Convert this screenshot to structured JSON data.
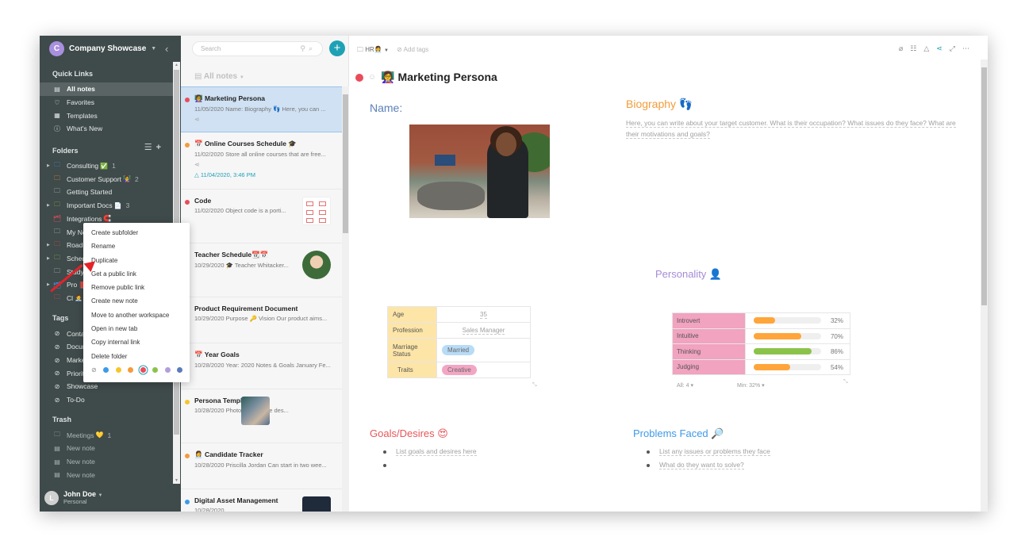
{
  "sidebar": {
    "workspace": {
      "avatar": "C",
      "name": "Company Showcase"
    },
    "quick_links_label": "Quick Links",
    "quick_links": [
      {
        "icon": "note-icon",
        "label": "All notes",
        "active": true
      },
      {
        "icon": "heart-icon",
        "label": "Favorites"
      },
      {
        "icon": "templates-icon",
        "label": "Templates"
      },
      {
        "icon": "info-icon",
        "label": "What's New"
      }
    ],
    "folders_label": "Folders",
    "folders": [
      {
        "label": "Consulting",
        "emoji": "✅",
        "count": "1",
        "color": "#3d9ae8",
        "expandable": true
      },
      {
        "label": "Customer Support",
        "emoji": "👩‍🏫",
        "count": "2",
        "color": "#f39c3a"
      },
      {
        "label": "Getting Started",
        "color": "#c8cfcf"
      },
      {
        "label": "Important Docs",
        "emoji": "📄",
        "count": "3",
        "color": "#8bc34a",
        "expandable": true
      },
      {
        "label": "Integrations",
        "emoji": "🧲",
        "color": "#ea4c5a",
        "shared": true
      },
      {
        "label": "My No",
        "color": "#c8cfcf"
      },
      {
        "label": "Roadm",
        "color": "#ea4c5a",
        "expandable": true
      },
      {
        "label": "Sched",
        "color": "#8bc34a",
        "expandable": true
      },
      {
        "label": "Studyi",
        "color": "#c8cfcf"
      },
      {
        "label": "Pro",
        "emoji": "📕",
        "color": "#3d9ae8",
        "expandable": true,
        "shared": true
      },
      {
        "label": "Cl",
        "emoji": "🧑‍💼",
        "color": "#ea4c5a"
      }
    ],
    "tags_label": "Tags",
    "tags": [
      "Conta",
      "Docum",
      "Marke",
      "Priority",
      "Showcase",
      "To-Do"
    ],
    "trash_label": "Trash",
    "trash": [
      {
        "icon": "folder-icon",
        "label": "Meetings",
        "emoji": "💛",
        "count": "1"
      },
      {
        "icon": "note-icon",
        "label": "New note"
      },
      {
        "icon": "note-icon",
        "label": "New note"
      },
      {
        "icon": "note-icon",
        "label": "New note"
      }
    ],
    "user": {
      "avatar": "L",
      "name": "John Doe",
      "workspace": "Personal"
    }
  },
  "context_menu": {
    "items": [
      "Create subfolder",
      "Rename",
      "Duplicate",
      "Get a public link",
      "Remove public link",
      "Create new note",
      "Move to another workspace",
      "Open in new tab",
      "Copy internal link",
      "Delete folder"
    ],
    "colors": [
      "#3d9ae8",
      "#f7c52b",
      "#f39c3a",
      "#ea4c5a",
      "#8bc34a",
      "#b39ddb",
      "#5c7bbd"
    ],
    "selected_color": "#ea4c5a"
  },
  "notes_list": {
    "search_placeholder": "Search",
    "title": "All notes",
    "notes": [
      {
        "title": "👩‍🏫 Marketing Persona",
        "snippet": "11/05/2020 Name: Biography 👣 Here, you can ...",
        "dot": "#ea4c5a",
        "selected": true,
        "shared": true
      },
      {
        "title": "📅 Online Courses Schedule 🎓",
        "snippet": "11/02/2020 Store all online courses that are free...",
        "dot": "#f39c3a",
        "shared": true,
        "reminder": "11/04/2020, 3:46 PM"
      },
      {
        "title": "Code",
        "snippet": "11/02/2020 Object code is a porti...",
        "dot": "#ea4c5a",
        "thumb": "code"
      },
      {
        "title": "Teacher Schedule📆📅",
        "snippet": "10/29/2020 🎓 Teacher Whitacker...",
        "thumb": "round"
      },
      {
        "title": "Product Requirement Document",
        "snippet": "10/29/2020 Purpose 🔑 Vision Our product aims..."
      },
      {
        "title": "📅 Year Goals",
        "snippet": "10/28/2020 Year: 2020 Notes & Goals January Fe..."
      },
      {
        "title": "Persona Template",
        "snippet": "10/28/2020 Photo Bio Include des...",
        "dot": "#f7c52b",
        "thumb": "photo"
      },
      {
        "title": "👩‍💼 Candidate Tracker",
        "snippet": "10/28/2020 Priscilla Jordan Can start in two wee...",
        "dot": "#f39c3a"
      },
      {
        "title": "Digital Asset Management",
        "snippet": "10/28/2020 ...",
        "dot": "#3d9ae8",
        "thumb": "dam"
      }
    ]
  },
  "editor": {
    "folder": "HR👩‍💼",
    "add_tags": "Add tags",
    "title": "👩‍🏫 Marketing Persona",
    "name_heading": "Name:",
    "bio_heading": "Biography 👣",
    "bio_text": "Here, you can write about your target customer. What is their occupation? What issues do they face? What are their motivations and goals?",
    "personality_heading": "Personality 👤",
    "info_table": [
      {
        "key": "Age",
        "value": "35",
        "type": "text"
      },
      {
        "key": "Profession",
        "value": "Sales Manager",
        "type": "text"
      },
      {
        "key": "Marriage Status",
        "value": "Married",
        "type": "pill-blue"
      },
      {
        "key": "Traits",
        "value": "Creative",
        "type": "pill-pink"
      }
    ],
    "personality_table": [
      {
        "trait": "Introvert",
        "percent": 32,
        "color": "#ffa53a"
      },
      {
        "trait": "Intuitive",
        "percent": 70,
        "color": "#ffa53a"
      },
      {
        "trait": "Thinking",
        "percent": 86,
        "color": "#8bc34a"
      },
      {
        "trait": "Judging",
        "percent": 54,
        "color": "#ffa53a"
      }
    ],
    "personality_footer": {
      "all": "All: 4",
      "min": "Min: 32%"
    },
    "goals_heading": "Goals/Desires 😍",
    "goals": [
      "List goals and desires here",
      ""
    ],
    "problems_heading": "Problems Faced 🔎",
    "problems": [
      "List any issues or problems they face",
      "What do they want to solve?"
    ]
  }
}
